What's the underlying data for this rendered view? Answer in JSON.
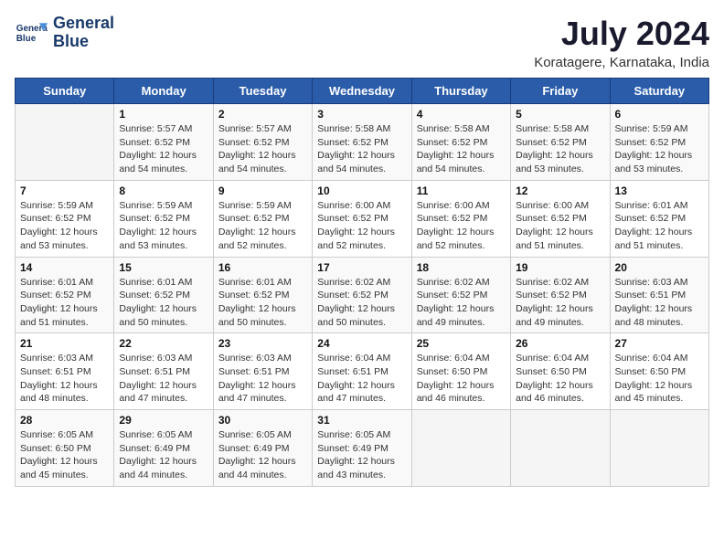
{
  "header": {
    "logo_line1": "General",
    "logo_line2": "Blue",
    "main_title": "July 2024",
    "subtitle": "Koratagere, Karnataka, India"
  },
  "weekdays": [
    "Sunday",
    "Monday",
    "Tuesday",
    "Wednesday",
    "Thursday",
    "Friday",
    "Saturday"
  ],
  "weeks": [
    [
      {
        "day": null
      },
      {
        "day": "1",
        "sunrise": "5:57 AM",
        "sunset": "6:52 PM",
        "daylight": "12 hours and 54 minutes."
      },
      {
        "day": "2",
        "sunrise": "5:57 AM",
        "sunset": "6:52 PM",
        "daylight": "12 hours and 54 minutes."
      },
      {
        "day": "3",
        "sunrise": "5:58 AM",
        "sunset": "6:52 PM",
        "daylight": "12 hours and 54 minutes."
      },
      {
        "day": "4",
        "sunrise": "5:58 AM",
        "sunset": "6:52 PM",
        "daylight": "12 hours and 54 minutes."
      },
      {
        "day": "5",
        "sunrise": "5:58 AM",
        "sunset": "6:52 PM",
        "daylight": "12 hours and 53 minutes."
      },
      {
        "day": "6",
        "sunrise": "5:59 AM",
        "sunset": "6:52 PM",
        "daylight": "12 hours and 53 minutes."
      }
    ],
    [
      {
        "day": "7",
        "sunrise": "5:59 AM",
        "sunset": "6:52 PM",
        "daylight": "12 hours and 53 minutes."
      },
      {
        "day": "8",
        "sunrise": "5:59 AM",
        "sunset": "6:52 PM",
        "daylight": "12 hours and 53 minutes."
      },
      {
        "day": "9",
        "sunrise": "5:59 AM",
        "sunset": "6:52 PM",
        "daylight": "12 hours and 52 minutes."
      },
      {
        "day": "10",
        "sunrise": "6:00 AM",
        "sunset": "6:52 PM",
        "daylight": "12 hours and 52 minutes."
      },
      {
        "day": "11",
        "sunrise": "6:00 AM",
        "sunset": "6:52 PM",
        "daylight": "12 hours and 52 minutes."
      },
      {
        "day": "12",
        "sunrise": "6:00 AM",
        "sunset": "6:52 PM",
        "daylight": "12 hours and 51 minutes."
      },
      {
        "day": "13",
        "sunrise": "6:01 AM",
        "sunset": "6:52 PM",
        "daylight": "12 hours and 51 minutes."
      }
    ],
    [
      {
        "day": "14",
        "sunrise": "6:01 AM",
        "sunset": "6:52 PM",
        "daylight": "12 hours and 51 minutes."
      },
      {
        "day": "15",
        "sunrise": "6:01 AM",
        "sunset": "6:52 PM",
        "daylight": "12 hours and 50 minutes."
      },
      {
        "day": "16",
        "sunrise": "6:01 AM",
        "sunset": "6:52 PM",
        "daylight": "12 hours and 50 minutes."
      },
      {
        "day": "17",
        "sunrise": "6:02 AM",
        "sunset": "6:52 PM",
        "daylight": "12 hours and 50 minutes."
      },
      {
        "day": "18",
        "sunrise": "6:02 AM",
        "sunset": "6:52 PM",
        "daylight": "12 hours and 49 minutes."
      },
      {
        "day": "19",
        "sunrise": "6:02 AM",
        "sunset": "6:52 PM",
        "daylight": "12 hours and 49 minutes."
      },
      {
        "day": "20",
        "sunrise": "6:03 AM",
        "sunset": "6:51 PM",
        "daylight": "12 hours and 48 minutes."
      }
    ],
    [
      {
        "day": "21",
        "sunrise": "6:03 AM",
        "sunset": "6:51 PM",
        "daylight": "12 hours and 48 minutes."
      },
      {
        "day": "22",
        "sunrise": "6:03 AM",
        "sunset": "6:51 PM",
        "daylight": "12 hours and 47 minutes."
      },
      {
        "day": "23",
        "sunrise": "6:03 AM",
        "sunset": "6:51 PM",
        "daylight": "12 hours and 47 minutes."
      },
      {
        "day": "24",
        "sunrise": "6:04 AM",
        "sunset": "6:51 PM",
        "daylight": "12 hours and 47 minutes."
      },
      {
        "day": "25",
        "sunrise": "6:04 AM",
        "sunset": "6:50 PM",
        "daylight": "12 hours and 46 minutes."
      },
      {
        "day": "26",
        "sunrise": "6:04 AM",
        "sunset": "6:50 PM",
        "daylight": "12 hours and 46 minutes."
      },
      {
        "day": "27",
        "sunrise": "6:04 AM",
        "sunset": "6:50 PM",
        "daylight": "12 hours and 45 minutes."
      }
    ],
    [
      {
        "day": "28",
        "sunrise": "6:05 AM",
        "sunset": "6:50 PM",
        "daylight": "12 hours and 45 minutes."
      },
      {
        "day": "29",
        "sunrise": "6:05 AM",
        "sunset": "6:49 PM",
        "daylight": "12 hours and 44 minutes."
      },
      {
        "day": "30",
        "sunrise": "6:05 AM",
        "sunset": "6:49 PM",
        "daylight": "12 hours and 44 minutes."
      },
      {
        "day": "31",
        "sunrise": "6:05 AM",
        "sunset": "6:49 PM",
        "daylight": "12 hours and 43 minutes."
      },
      {
        "day": null
      },
      {
        "day": null
      },
      {
        "day": null
      }
    ]
  ]
}
